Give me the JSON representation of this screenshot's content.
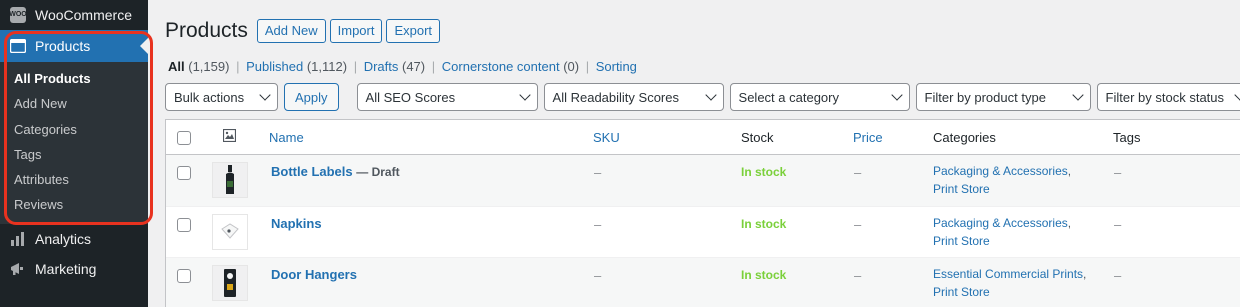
{
  "sidebar": {
    "woocommerce": "WooCommerce",
    "woo_badge": "WOO",
    "products": "Products",
    "submenu": [
      "All Products",
      "Add New",
      "Categories",
      "Tags",
      "Attributes",
      "Reviews"
    ],
    "analytics": "Analytics",
    "marketing": "Marketing"
  },
  "header": {
    "title": "Products",
    "buttons": [
      "Add New",
      "Import",
      "Export"
    ]
  },
  "views": {
    "all_label": "All",
    "all_count": "(1,159)",
    "published_label": "Published",
    "published_count": "(1,112)",
    "drafts_label": "Drafts",
    "drafts_count": "(47)",
    "cornerstone_label": "Cornerstone content",
    "cornerstone_count": "(0)",
    "sorting_label": "Sorting",
    "separator": "|"
  },
  "filters": {
    "bulk_actions": "Bulk actions",
    "apply": "Apply",
    "seo": "All SEO Scores",
    "readability": "All Readability Scores",
    "category": "Select a category",
    "product_type": "Filter by product type",
    "stock_status": "Filter by stock status"
  },
  "table": {
    "columns": [
      "Name",
      "SKU",
      "Stock",
      "Price",
      "Categories",
      "Tags"
    ],
    "rows": [
      {
        "name": "Bottle Labels",
        "status": "— Draft",
        "sku": "–",
        "stock": "In stock",
        "price": "–",
        "cat1": "Packaging & Accessories",
        "cat2": "Print Store",
        "tags": "–"
      },
      {
        "name": "Napkins",
        "status": "",
        "sku": "–",
        "stock": "In stock",
        "price": "–",
        "cat1": "Packaging & Accessories",
        "cat2": "Print Store",
        "tags": "–"
      },
      {
        "name": "Door Hangers",
        "status": "",
        "sku": "–",
        "stock": "In stock",
        "price": "–",
        "cat1": "Essential Commercial Prints",
        "cat2": "Print Store",
        "tags": "–"
      }
    ],
    "comma": ","
  },
  "colors": {
    "accent": "#2271b1",
    "sidebar": "#1d2327",
    "in_stock": "#7ad03a",
    "highlight": "#e8321f"
  }
}
